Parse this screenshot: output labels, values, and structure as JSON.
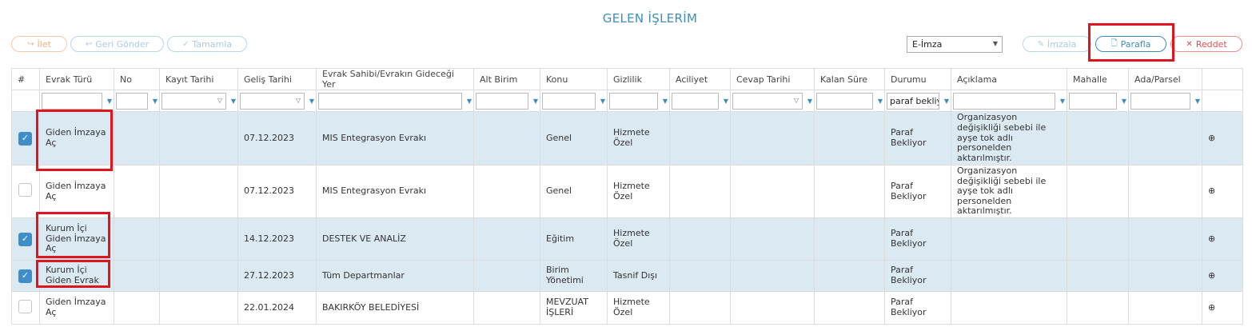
{
  "page": {
    "title": "GELEN İŞLERİM"
  },
  "toolbar": {
    "ilet": "İlet",
    "geri_gonder": "Geri Gönder",
    "tamamla": "Tamamla",
    "signature_select": "E-İmza",
    "imzala": "İmzala",
    "parafla": "Parafla",
    "reddet": "Reddet"
  },
  "table": {
    "headers": [
      "#",
      "Evrak Türü",
      "No",
      "Kayıt Tarihi",
      "Geliş Tarihi",
      "Evrak Sahibi/Evrakın Gideceği Yer",
      "Alt Birim",
      "Konu",
      "Gizlilik",
      "Aciliyet",
      "Cevap Tarihi",
      "Kalan Süre",
      "Durumu",
      "Açıklama",
      "Mahalle",
      "Ada/Parsel"
    ],
    "filters": {
      "durumu": "paraf bekliy"
    },
    "rows": [
      {
        "selected": true,
        "evrak_turu": "Giden İmzaya Aç",
        "no": "",
        "kayit_tarihi": "",
        "gelis_tarihi": "07.12.2023",
        "evrak_sahibi": "MIS Entegrasyon Evrakı",
        "alt_birim": "",
        "konu": "Genel",
        "gizlilik": "Hizmete Özel",
        "aciliyet": "",
        "cevap_tarihi": "",
        "kalan_sure": "",
        "durumu": "Paraf Bekliyor",
        "aciklama": "Organizasyon değişikliği sebebi ile ayşe tok adlı personelden aktarılmıştır.",
        "mahalle": "",
        "ada_parsel": ""
      },
      {
        "selected": false,
        "evrak_turu": "Giden İmzaya Aç",
        "no": "",
        "kayit_tarihi": "",
        "gelis_tarihi": "07.12.2023",
        "evrak_sahibi": "MIS Entegrasyon Evrakı",
        "alt_birim": "",
        "konu": "Genel",
        "gizlilik": "Hizmete Özel",
        "aciliyet": "",
        "cevap_tarihi": "",
        "kalan_sure": "",
        "durumu": "Paraf Bekliyor",
        "aciklama": "Organizasyon değişikliği sebebi ile ayşe tok adlı personelden aktarılmıştır.",
        "mahalle": "",
        "ada_parsel": ""
      },
      {
        "selected": true,
        "evrak_turu": "Kurum İçi Giden İmzaya Aç",
        "no": "",
        "kayit_tarihi": "",
        "gelis_tarihi": "14.12.2023",
        "evrak_sahibi": "DESTEK VE ANALİZ",
        "alt_birim": "",
        "konu": "Eğitim",
        "gizlilik": "Hizmete Özel",
        "aciliyet": "",
        "cevap_tarihi": "",
        "kalan_sure": "",
        "durumu": "Paraf Bekliyor",
        "aciklama": "",
        "mahalle": "",
        "ada_parsel": ""
      },
      {
        "selected": true,
        "evrak_turu": "Kurum İçi Giden Evrak",
        "no": "",
        "kayit_tarihi": "",
        "gelis_tarihi": "27.12.2023",
        "evrak_sahibi": "Tüm Departmanlar",
        "alt_birim": "",
        "konu": "Birim Yönetimi",
        "gizlilik": "Tasnif Dışı",
        "aciliyet": "",
        "cevap_tarihi": "",
        "kalan_sure": "",
        "durumu": "Paraf Bekliyor",
        "aciklama": "",
        "mahalle": "",
        "ada_parsel": ""
      },
      {
        "selected": false,
        "evrak_turu": "Giden İmzaya Aç",
        "no": "",
        "kayit_tarihi": "",
        "gelis_tarihi": "22.01.2024",
        "evrak_sahibi": "BAKIRKÖY BELEDİYESİ",
        "alt_birim": "",
        "konu": "MEVZUAT İŞLERİ",
        "gizlilik": "Hizmete Özel",
        "aciliyet": "",
        "cevap_tarihi": "",
        "kalan_sure": "",
        "durumu": "Paraf Bekliyor",
        "aciklama": "",
        "mahalle": "",
        "ada_parsel": ""
      }
    ]
  },
  "colors": {
    "accent": "#3c8dbc",
    "selected_row": "#dbe9f3",
    "highlight": "#e0141e",
    "reject": "#e05050"
  }
}
